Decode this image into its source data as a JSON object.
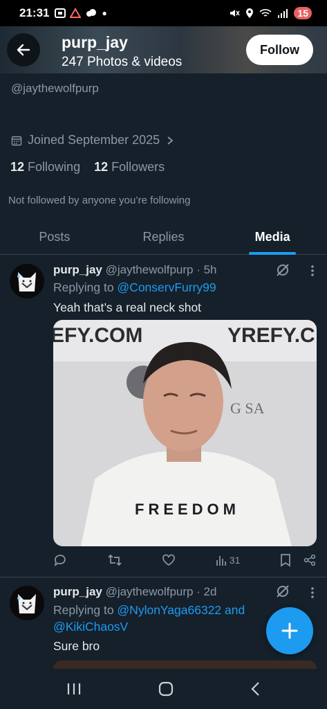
{
  "status_bar": {
    "time": "21:31",
    "battery": "15"
  },
  "header": {
    "name": "purp_jay",
    "media_count": "247 Photos & videos",
    "follow_label": "Follow"
  },
  "profile": {
    "handle": "@jaythewolfpurp",
    "joined": "Joined September 2025",
    "following_count": "12",
    "following_label": "Following",
    "followers_count": "12",
    "followers_label": "Followers",
    "not_followed": "Not followed by anyone you’re following"
  },
  "tabs": [
    {
      "label": "Posts",
      "active": false
    },
    {
      "label": "Replies",
      "active": false
    },
    {
      "label": "Media",
      "active": true
    }
  ],
  "posts": [
    {
      "name": "purp_jay",
      "handle": "@jaythewolfpurp",
      "time": "· 5h",
      "replying_prefix": "Replying to ",
      "replying_to": "@ConservFurry99",
      "text": "Yeah that’s a real neck shot",
      "media_text": {
        "top_left": "EFY.COM",
        "top_right": "YREFY.C",
        "shirt": "FREEDOM",
        "side": "G SA"
      },
      "views": "31"
    },
    {
      "name": "purp_jay",
      "handle": "@jaythewolfpurp",
      "time": "· 2d",
      "replying_prefix": "Replying to ",
      "replying_to": "@NylonYaga66322 and",
      "replying_to_2": "@KikiChaosV",
      "text": "Sure bro"
    }
  ],
  "colors": {
    "accent": "#1d9bf0",
    "background": "#15202b",
    "muted": "#8b98a5"
  },
  "icons": [
    "back-arrow-icon",
    "calendar-icon",
    "chevron-right-icon",
    "grok-icon",
    "more-icon",
    "reply-icon",
    "retweet-icon",
    "like-icon",
    "views-icon",
    "bookmark-icon",
    "share-icon",
    "compose-plus-icon"
  ]
}
